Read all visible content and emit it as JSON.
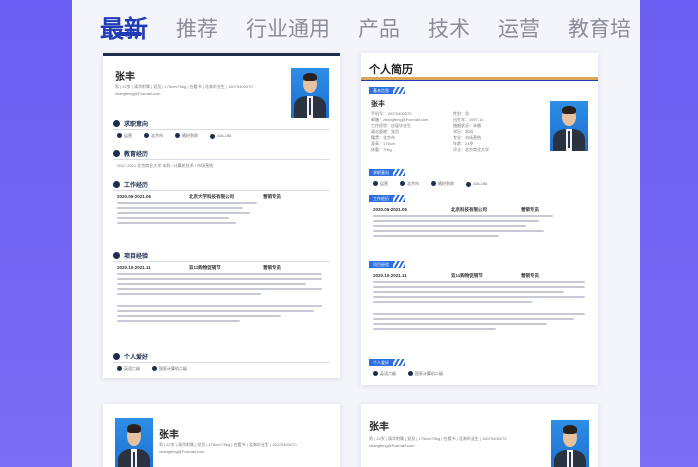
{
  "tabs": [
    {
      "label": "最新",
      "active": true
    },
    {
      "label": "推荐",
      "active": false
    },
    {
      "label": "行业通用",
      "active": false
    },
    {
      "label": "产品",
      "active": false
    },
    {
      "label": "技术",
      "active": false
    },
    {
      "label": "运营",
      "active": false
    },
    {
      "label": "教育培",
      "active": false
    }
  ],
  "card1": {
    "name": "张丰",
    "contact_line": "男 | 22岁 | 清华附属 | 党员 | 175cm/70kg | 在看书 | 北海毕业生 | 15070400070",
    "email": "zhangfeng@Foxmail.com",
    "sections": {
      "intent": "求职意向",
      "education": "教育经历",
      "work": "工作经历",
      "project": "项目经验",
      "hobby": "个人爱好"
    },
    "intent_tags": [
      "运营",
      "北京市",
      "随时到岗",
      "10k-15k"
    ],
    "edu_row": "2017-2021        北京商业大学        本科 / 计算机技术 / 市场营销",
    "work_row": [
      "2020.05-2021.05",
      "北京大学科技有限公司",
      "营销专员"
    ],
    "project_row": [
      "2020.10-2021.11",
      "双11购物促销节",
      "营销专员"
    ],
    "hobby_tags": [
      "英语六级",
      "国家计算机二级"
    ]
  },
  "card2": {
    "title": "个人简历",
    "name": "张丰",
    "pill_basic": "基本信息",
    "pill_intent": "求职意向",
    "pill_work": "工作经历",
    "pill_project": "项目经验",
    "pill_hobby": "个人爱好",
    "info_left": [
      "手机号：15070400070",
      "邮箱：zhangfeng@Foxmail.com",
      "工作经验：应届毕业生",
      "政治面貌：党员",
      "籍贯：北京市",
      "身高：175cm",
      "体重：70kg"
    ],
    "info_right": [
      "性别：男",
      "出生年：1997.10",
      "婚姻状况：未婚",
      "学历：本科",
      "专业：市场营销",
      "年龄：24岁",
      "毕业：北京商业大学"
    ],
    "intent_tags": [
      "运营",
      "北京市",
      "随时到岗",
      "10k-15k"
    ],
    "work_row": [
      "2020.05-2021.05",
      "北京科技有限公司",
      "营销专员"
    ],
    "project_row": [
      "2020.10-2021.11",
      "双11购物促销节",
      "营销专员"
    ],
    "hobby_tags": [
      "英语六级",
      "国家计算机二级"
    ]
  },
  "card3": {
    "name": "张丰",
    "contact_line": "男 | 22岁 | 清华附属 | 党员 | 175cm/70kg | 在看书 | 北海毕业生 | 15070400070",
    "email": "zhangfeng@Foxmail.com"
  },
  "card4": {
    "name": "张丰",
    "contact_line": "男 | 22岁 | 清华附属 | 党员 | 175cm/70kg | 在看书 | 北海毕业生 | 15070400070",
    "email": "zhangfeng@Foxmail.com"
  }
}
